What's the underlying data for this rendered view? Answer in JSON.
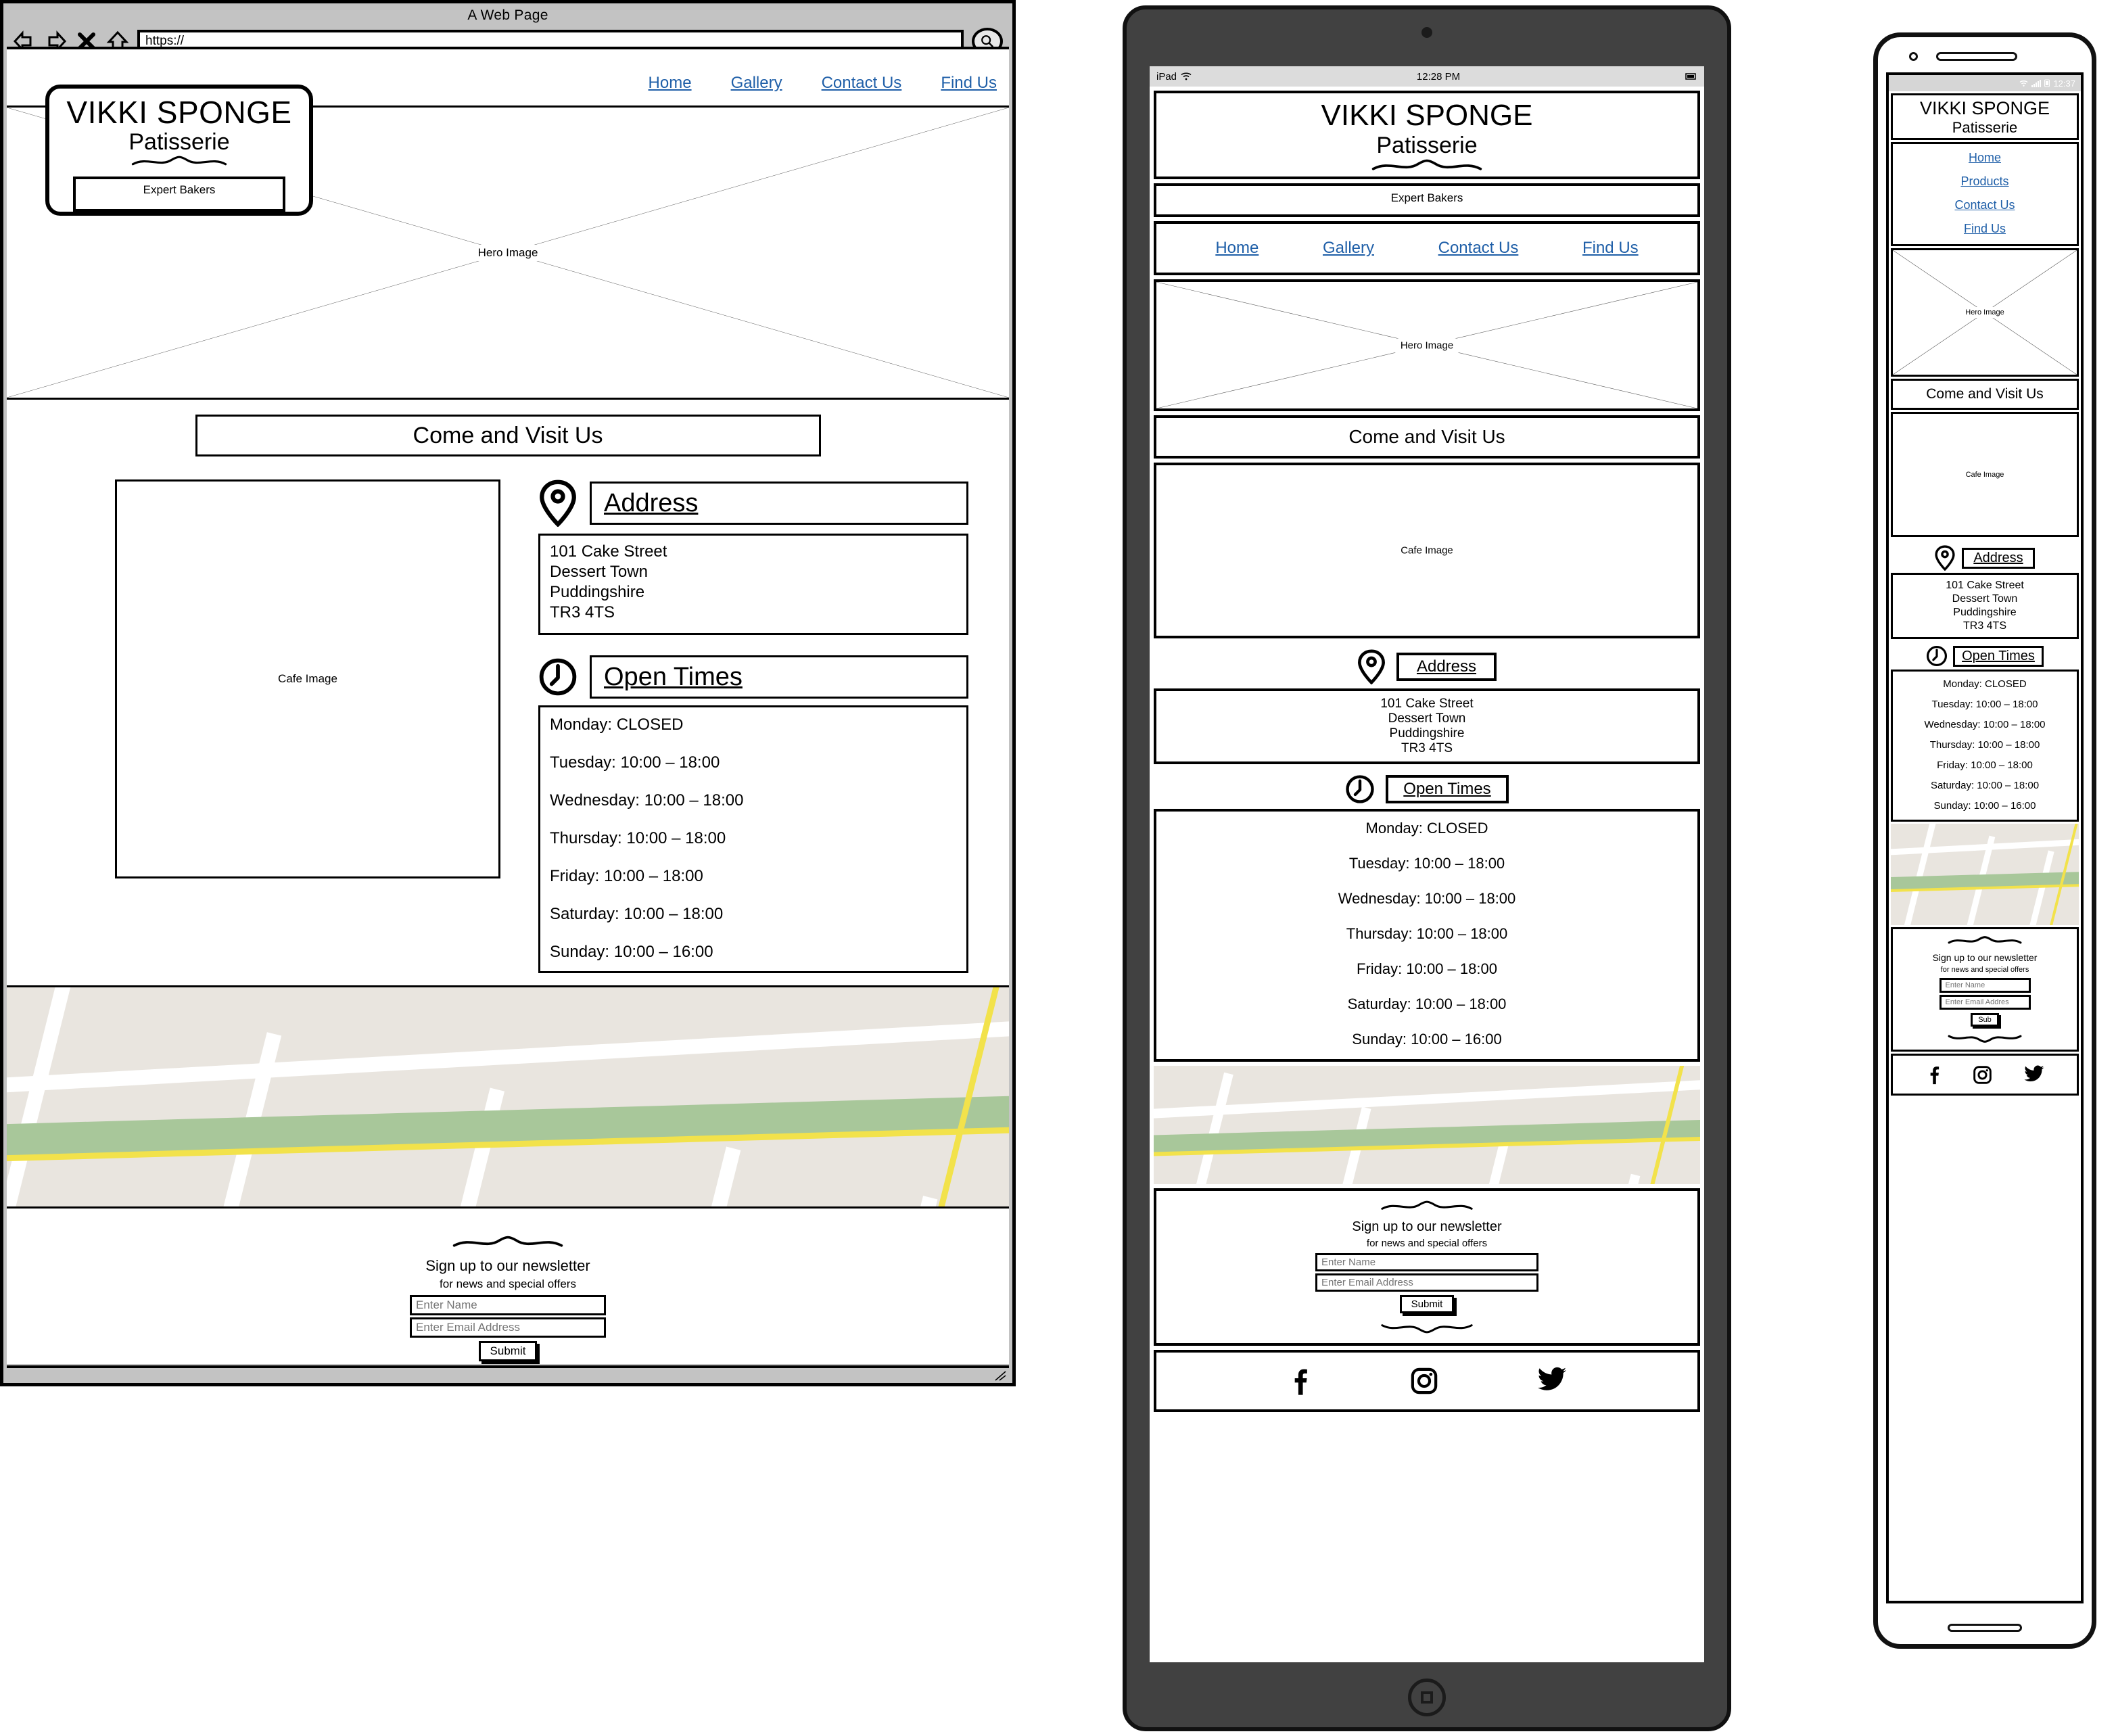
{
  "browser": {
    "window_title": "A Web Page",
    "url_value": "https://",
    "back_icon": "back-arrow-icon",
    "forward_icon": "forward-arrow-icon",
    "stop_icon": "stop-x-icon",
    "home_icon": "home-icon",
    "search_icon": "search-icon"
  },
  "brand": {
    "name": "VIKKI SPONGE",
    "sub": "Patisserie",
    "tagline": "Expert Bakers"
  },
  "nav_desktop": [
    {
      "label": "Home"
    },
    {
      "label": "Gallery"
    },
    {
      "label": "Contact Us"
    },
    {
      "label": "Find Us"
    }
  ],
  "nav_tablet": [
    {
      "label": "Home"
    },
    {
      "label": "Gallery"
    },
    {
      "label": "Contact Us"
    },
    {
      "label": "Find Us"
    }
  ],
  "nav_phone": [
    {
      "label": "Home"
    },
    {
      "label": "Products"
    },
    {
      "label": "Contact Us"
    },
    {
      "label": "Find Us"
    }
  ],
  "placeholders": {
    "hero": "Hero Image",
    "cafe": "Cafe Image"
  },
  "section": {
    "visit_heading": "Come and Visit Us",
    "address_title": "Address",
    "open_times_title": "Open Times",
    "pin_icon": "map-pin-icon",
    "clock_icon": "clock-icon"
  },
  "address": [
    "101 Cake Street",
    "Dessert Town",
    "Puddingshire",
    "TR3 4TS"
  ],
  "hours": [
    "Monday: CLOSED",
    "Tuesday: 10:00 – 18:00",
    "Wednesday: 10:00 – 18:00",
    "Thursday: 10:00 – 18:00",
    "Friday: 10:00 – 18:00",
    "Saturday: 10:00 – 18:00",
    "Sunday: 10:00 – 16:00"
  ],
  "newsletter": {
    "title": "Sign up to our newsletter",
    "subtitle": "for news and special offers",
    "name_placeholder": "Enter Name",
    "email_placeholder": "Enter Email Address",
    "email_placeholder_short": "Enter Email Addres",
    "submit_label": "Submit",
    "submit_label_short": "Sub"
  },
  "social": [
    {
      "name": "facebook-icon"
    },
    {
      "name": "instagram-icon"
    },
    {
      "name": "twitter-icon"
    }
  ],
  "tablet_device": {
    "status_left": "iPad",
    "status_time": "12:28 PM",
    "wifi_icon": "wifi-icon",
    "battery_icon": "battery-icon",
    "home_button": "home-button"
  },
  "phone_device": {
    "status_time": "12:37",
    "wifi_icon": "wifi-icon",
    "signal_icon": "signal-bars-icon",
    "battery_icon": "battery-icon"
  },
  "colors": {
    "link": "#1f5fa8",
    "chrome": "#c3c3c3",
    "map_bg": "#e9e5df",
    "map_road": "#ffffff",
    "map_park": "#a8c79a",
    "map_highway": "#f2e24b",
    "device_body": "#414141"
  }
}
